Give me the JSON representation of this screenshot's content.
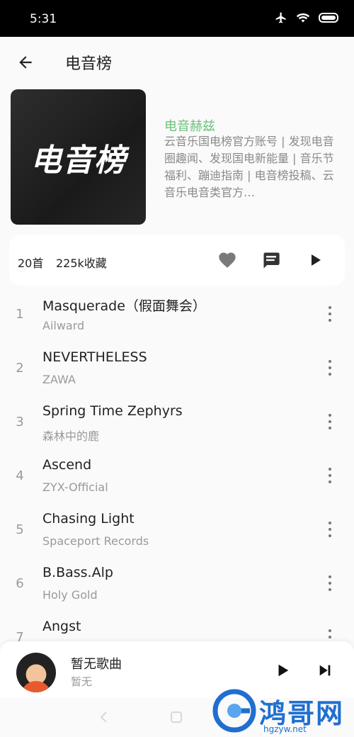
{
  "status": {
    "time": "5:31"
  },
  "appbar": {
    "title": "电音榜"
  },
  "playlist": {
    "cover_text": "电音榜",
    "owner": "电音赫兹",
    "description": "云音乐国电榜官方账号 | 发现电音圈趣闻、发现国电新能量 | 音乐节福利、蹦迪指南 | 电音榜投稿、云音乐电音类官方…",
    "song_count": "20首",
    "fav_count": "225k收藏"
  },
  "songs": [
    {
      "index": "1",
      "title": "Masquerade（假面舞会）",
      "artist": "Ailward"
    },
    {
      "index": "2",
      "title": "NEVERTHELESS",
      "artist": "ZAWA"
    },
    {
      "index": "3",
      "title": "Spring Time Zephyrs",
      "artist": "森林中的鹿"
    },
    {
      "index": "4",
      "title": "Ascend",
      "artist": "ZYX-Official"
    },
    {
      "index": "5",
      "title": "Chasing Light",
      "artist": "Spaceport Records"
    },
    {
      "index": "6",
      "title": "B.Bass.Alp",
      "artist": "Holy Gold"
    },
    {
      "index": "7",
      "title": "Angst",
      "artist": ""
    }
  ],
  "player": {
    "title": "暂无歌曲",
    "subtitle": "暂无"
  },
  "watermark": {
    "brand": "鸿哥网",
    "url": "hgzyw.net"
  },
  "colors": {
    "accent": "#6cc17b",
    "watermark": "#1f6fd1"
  },
  "icons": {
    "back": "arrow-left-icon",
    "like": "heart-icon",
    "comment": "comment-icon",
    "play": "play-icon",
    "next": "skip-next-icon",
    "more": "more-vertical-icon"
  }
}
